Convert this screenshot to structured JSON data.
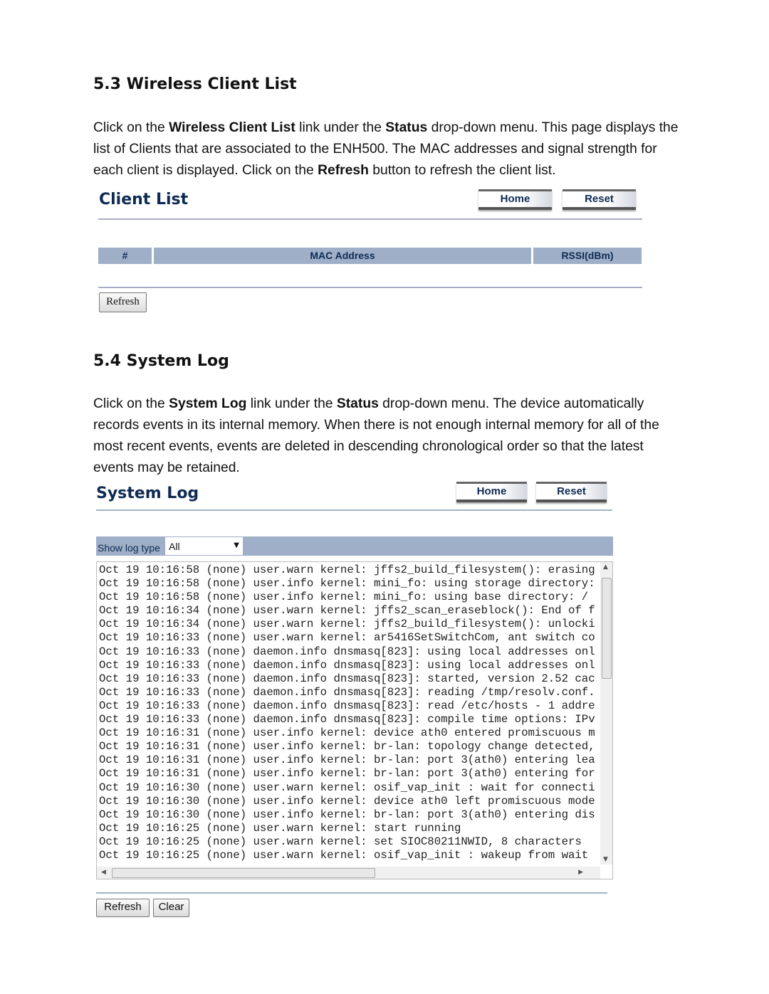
{
  "section_53": {
    "heading": "5.3 Wireless Client List",
    "para": [
      {
        "t": "Click on the "
      },
      {
        "b": "Wireless Client List"
      },
      {
        "t": " link under the "
      },
      {
        "b": "Status"
      },
      {
        "t": " drop-down menu. This page displays the list of Clients that are associated to the ENH500. The MAC addresses and signal strength for each client is displayed. Click on the "
      },
      {
        "b": "Refresh"
      },
      {
        "t": " button to refresh the client list."
      }
    ]
  },
  "client_list": {
    "title": "Client List",
    "home": "Home",
    "reset": "Reset",
    "columns": [
      "#",
      "MAC Address",
      "RSSI(dBm)"
    ],
    "refresh": "Refresh"
  },
  "section_54": {
    "heading": "5.4 System Log",
    "para": [
      {
        "t": "Click on the "
      },
      {
        "b": "System Log"
      },
      {
        "t": " link under the "
      },
      {
        "b": "Status"
      },
      {
        "t": " drop-down menu. The device automatically records events in its internal memory. When there is not enough internal memory for all of the most recent events, events are deleted in descending chronological order so that the latest events may be retained."
      }
    ]
  },
  "system_log": {
    "title": "System Log",
    "home": "Home",
    "reset": "Reset",
    "filter_label": "Show log type",
    "filter_value": "All",
    "lines": [
      "Oct 19 10:16:58 (none) user.warn kernel: jffs2_build_filesystem(): erasing",
      "Oct 19 10:16:58 (none) user.info kernel: mini_fo: using storage directory:",
      "Oct 19 10:16:58 (none) user.info kernel: mini_fo: using base directory: /",
      "Oct 19 10:16:34 (none) user.warn kernel: jffs2_scan_eraseblock(): End of f",
      "Oct 19 10:16:34 (none) user.warn kernel: jffs2_build_filesystem(): unlocki",
      "Oct 19 10:16:33 (none) user.warn kernel: ar5416SetSwitchCom, ant switch co",
      "Oct 19 10:16:33 (none) daemon.info dnsmasq[823]: using local addresses onl",
      "Oct 19 10:16:33 (none) daemon.info dnsmasq[823]: using local addresses onl",
      "Oct 19 10:16:33 (none) daemon.info dnsmasq[823]: started, version 2.52 cac",
      "Oct 19 10:16:33 (none) daemon.info dnsmasq[823]: reading /tmp/resolv.conf.",
      "Oct 19 10:16:33 (none) daemon.info dnsmasq[823]: read /etc/hosts - 1 addre",
      "Oct 19 10:16:33 (none) daemon.info dnsmasq[823]: compile time options: IPv",
      "Oct 19 10:16:31 (none) user.info kernel: device ath0 entered promiscuous m",
      "Oct 19 10:16:31 (none) user.info kernel: br-lan: topology change detected,",
      "Oct 19 10:16:31 (none) user.info kernel: br-lan: port 3(ath0) entering lea",
      "Oct 19 10:16:31 (none) user.info kernel: br-lan: port 3(ath0) entering for",
      "Oct 19 10:16:30 (none) user.warn kernel: osif_vap_init : wait for connecti",
      "Oct 19 10:16:30 (none) user.info kernel: device ath0 left promiscuous mode",
      "Oct 19 10:16:30 (none) user.info kernel: br-lan: port 3(ath0) entering dis",
      "Oct 19 10:16:25 (none) user.warn kernel: start running",
      "Oct 19 10:16:25 (none) user.warn kernel: set SIOC80211NWID, 8 characters",
      "Oct 19 10:16:25 (none) user.warn kernel: osif_vap_init : wakeup from wait"
    ],
    "refresh": "Refresh",
    "clear": "Clear"
  }
}
